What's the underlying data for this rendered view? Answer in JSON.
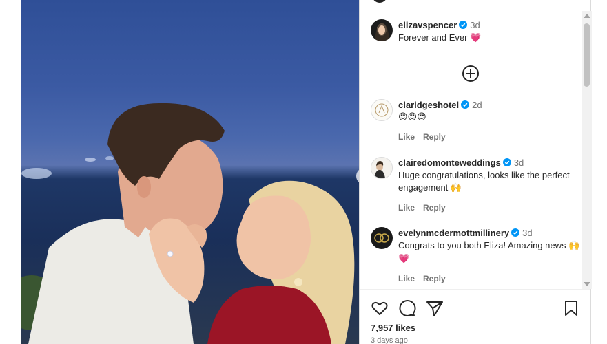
{
  "post": {
    "caption": {
      "username": "elizavspencer",
      "time": "3d",
      "text": "Forever and Ever",
      "text_emoji": "💗"
    },
    "comments": [
      {
        "username": "claridgeshotel",
        "time": "2d",
        "text": "😍😍😍",
        "like_label": "Like",
        "reply_label": "Reply"
      },
      {
        "username": "clairedomonteweddings",
        "time": "3d",
        "text": "Huge congratulations, looks like the perfect engagement",
        "text_emoji": "🙌",
        "like_label": "Like",
        "reply_label": "Reply"
      },
      {
        "username": "evelynmcdermottmillinery",
        "time": "3d",
        "text": "Congrats to you both Eliza! Amazing news",
        "text_emoji": "🙌💗",
        "like_label": "Like",
        "reply_label": "Reply"
      }
    ],
    "likes": "7,957 likes",
    "date": "3 days ago"
  },
  "icons": {
    "verified": "verified-badge-icon",
    "load_more": "plus-circle-icon",
    "like": "heart-icon",
    "comment": "comment-icon",
    "share": "share-icon",
    "save": "bookmark-icon",
    "next": "chevron-right-icon"
  },
  "colors": {
    "verified_blue": "#0095f6",
    "heart_pink": "#e83e8c",
    "text_secondary": "#737373"
  }
}
